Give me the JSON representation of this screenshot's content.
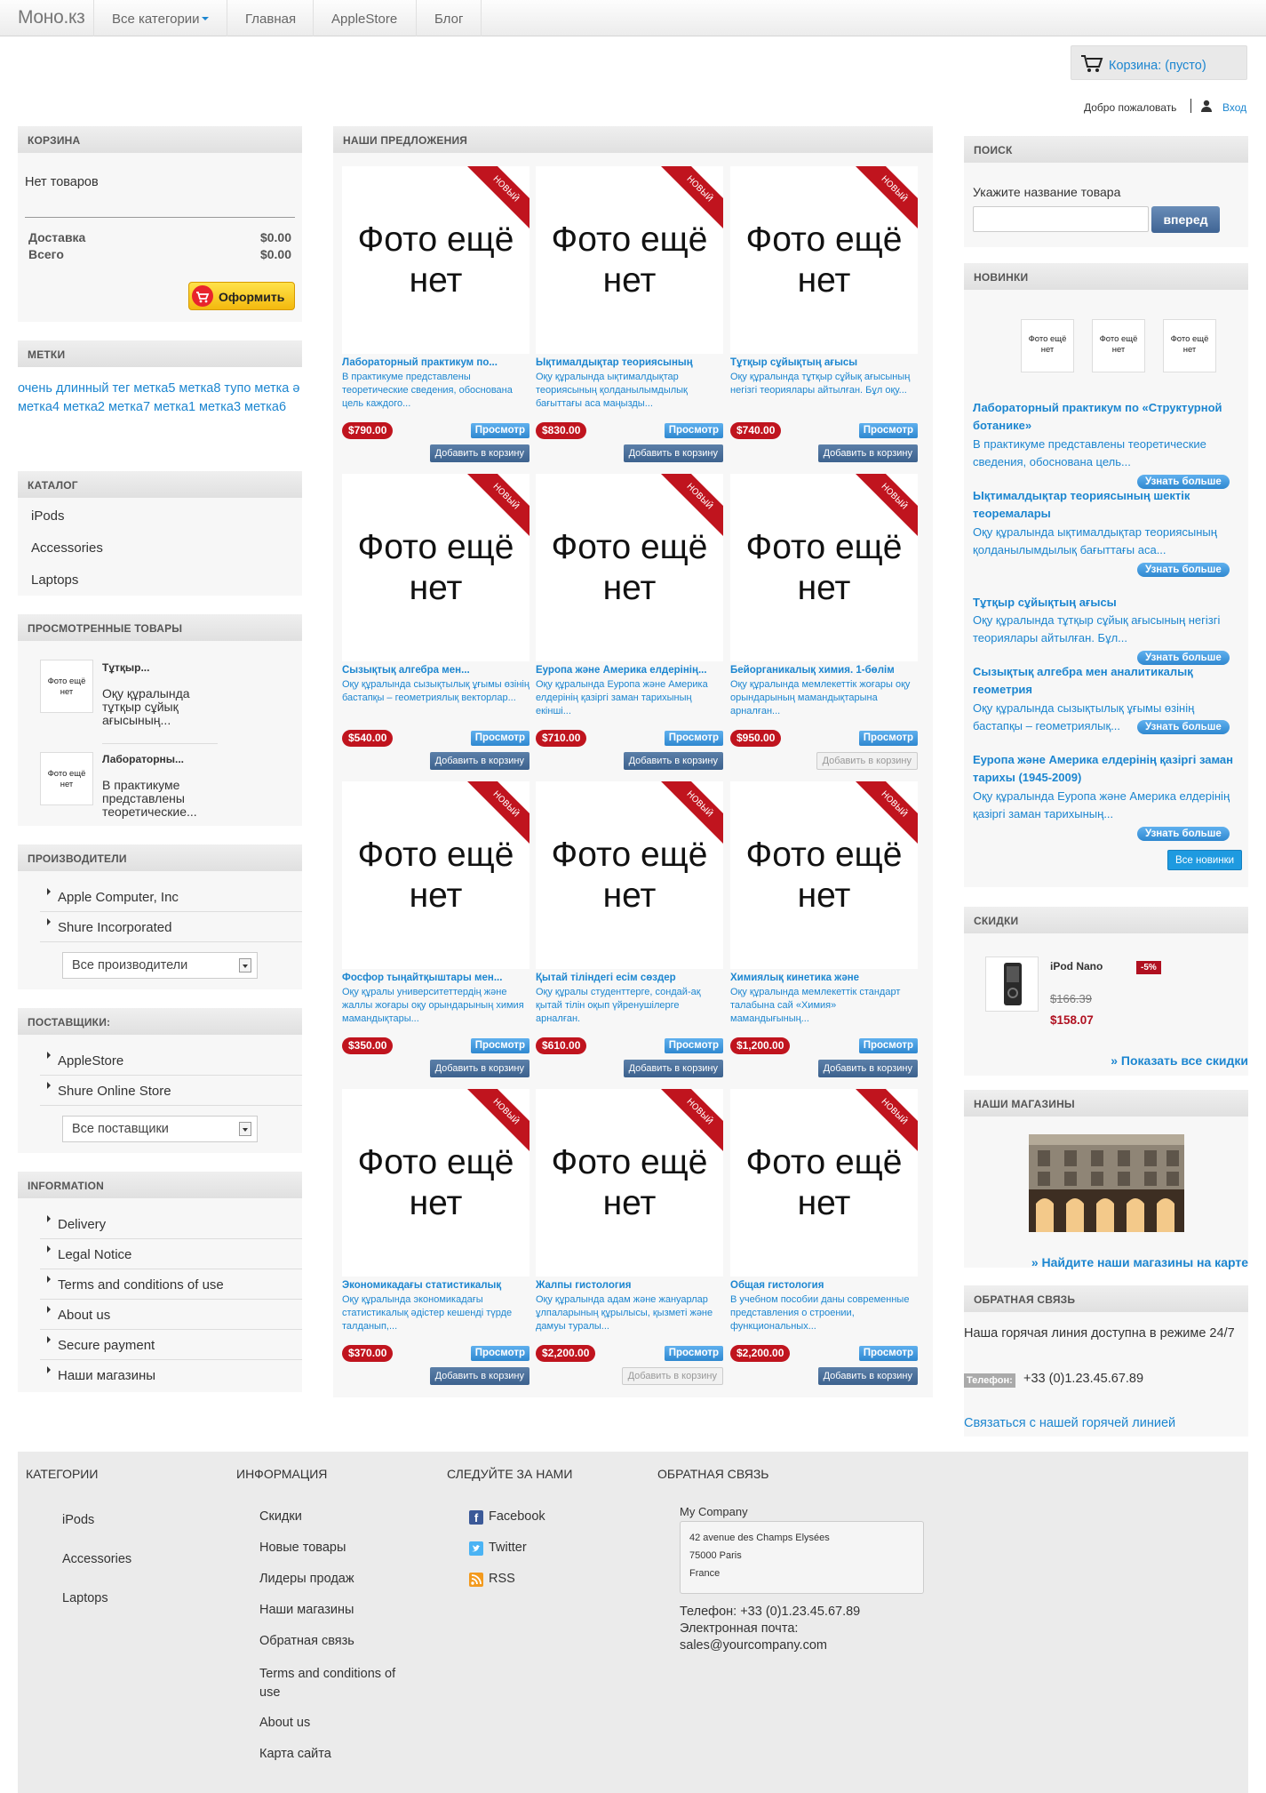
{
  "header": {
    "logo": "Моно.кз",
    "nav": [
      "Все категории",
      "Главная",
      "AppleStore",
      "Блог"
    ],
    "cart_label": "Корзина: (пусто)",
    "welcome": "Добро пожаловать",
    "login": "Вход"
  },
  "left": {
    "cart": {
      "title": "КОРЗИНА",
      "empty": "Нет товаров",
      "delivery_label": "Доставка",
      "delivery_value": "$0.00",
      "total_label": "Всего",
      "total_value": "$0.00",
      "checkout": "Оформить"
    },
    "tags": {
      "title": "МЕТКИ",
      "text": "очень длинный тег метка5 метка8 тупо метка ә метка4 метка2 метка7 метка1 метка3 метка6"
    },
    "catalog": {
      "title": "КАТАЛОГ",
      "items": [
        "iPods",
        "Accessories",
        "Laptops"
      ]
    },
    "viewed": {
      "title": "ПРОСМОТРЕННЫЕ ТОВАРЫ",
      "items": [
        {
          "thumb": "Фото ещё нет",
          "name": "Тұтқыр...",
          "desc": "Оқу құралында тұтқыр сұйық ағысының..."
        },
        {
          "thumb": "Фото ещё нет",
          "name": "Лабораторны...",
          "desc": "В практикуме представлены теоретические..."
        }
      ]
    },
    "manufacturers": {
      "title": "ПРОИЗВОДИТЕЛИ",
      "items": [
        "Apple Computer, Inc",
        "Shure Incorporated"
      ],
      "select": "Все производители"
    },
    "suppliers": {
      "title": "ПОСТАВЩИКИ:",
      "items": [
        "AppleStore",
        "Shure Online Store"
      ],
      "select": "Все поставщики"
    },
    "information": {
      "title": "INFORMATION",
      "items": [
        "Delivery",
        "Legal Notice",
        "Terms and conditions of use",
        "About us",
        "Secure payment",
        "Наши магазины"
      ]
    }
  },
  "center": {
    "title": "НАШИ ПРЕДЛОЖЕНИЯ",
    "no_photo": "Фото ещё нет",
    "ribbon": "НОВЫЙ",
    "view_label": "Просмотр",
    "add_label": "Добавить в корзину",
    "products": [
      {
        "title": "Лабораторный практикум по...",
        "desc": "В практикуме представлены теоретические сведения, обоснована цель каждого...",
        "price": "$790.00",
        "add_enabled": true
      },
      {
        "title": "Ықтималдықтар теориясының",
        "desc": "Оқу құралында ықтималдықтар теориясының қолданылымдылық бағыттағы аса маңызды...",
        "price": "$830.00",
        "add_enabled": true
      },
      {
        "title": "Тұтқыр сұйықтың ағысы",
        "desc": "Оқу құралында тұтқыр сұйық ағысының негізгі теориялары айтылған. Бұл оқу...",
        "price": "$740.00",
        "add_enabled": true
      },
      {
        "title": "Сызықтық алгебра мен...",
        "desc": "Оқу құралында сызықтылық ұғымы өзінің бастапқы – геометриялық векторлар...",
        "price": "$540.00",
        "add_enabled": true
      },
      {
        "title": "Еуропа және Америка елдерінің...",
        "desc": "Оқу құралында Еуропа және Америка елдерінің қазіргі заман тарихының екінші...",
        "price": "$710.00",
        "add_enabled": true
      },
      {
        "title": "Бейорганикалық химия. 1-бөлім",
        "desc": "Оқу құралында мемлекеттік жоғары оқу орындарының мамандықтарына арналған...",
        "price": "$950.00",
        "add_enabled": false
      },
      {
        "title": "Фосфор тыңайтқыштары мен...",
        "desc": "Оқу құралы университеттердің және жаллы жоғары оқу орындарының химия мамандықтары...",
        "price": "$350.00",
        "add_enabled": true
      },
      {
        "title": "Қытай тіліндегі есім сөздер",
        "desc": "Оқу құралы студенттерге, сондай-ақ қытай тілін оқып үйренушілерге арналған.",
        "price": "$610.00",
        "add_enabled": true
      },
      {
        "title": "Химиялық кинетика және",
        "desc": "Оқу құралында мемлекеттік стандарт талабына сай «Химия» мамандығының...",
        "price": "$1,200.00",
        "add_enabled": true
      },
      {
        "title": "Экономикадағы статистикалық",
        "desc": "Оқу құралында экономикадағы статистикалық әдістер кешенді түрде талданып,...",
        "price": "$370.00",
        "add_enabled": true
      },
      {
        "title": "Жалпы гистология",
        "desc": "Оқу құралында адам және жануарлар ұлпаларының құрылысы, қызметі және дамуы туралы...",
        "price": "$2,200.00",
        "add_enabled": false
      },
      {
        "title": "Общая гистология",
        "desc": "В учебном пособии даны современные представления о строении, функциональных...",
        "price": "$2,200.00",
        "add_enabled": true
      }
    ]
  },
  "right": {
    "search": {
      "title": "ПОИСК",
      "label": "Укажите название товара",
      "placeholder": "",
      "button": "вперед"
    },
    "new": {
      "title": "НОВИНКИ",
      "thumb": "Фото ещё нет",
      "more": "Узнать больше",
      "all": "Все новинки",
      "items": [
        {
          "title": "Лабораторный практикум по «Структурной ботанике»",
          "desc": "В практикуме представлены теоретические сведения, обоснована цель..."
        },
        {
          "title": "Ықтималдықтар теориясының шектік теоремалары",
          "desc": "Оқу құралында ықтималдықтар теориясының қолданылымдылық бағыттағы аса..."
        },
        {
          "title": "Тұтқыр сұйықтың ағысы",
          "desc": "Оқу құралында тұтқыр сұйық ағысының негізгі теориялары айтылған. Бұл..."
        },
        {
          "title": "Сызықтық алгебра мен аналитикалық геометрия",
          "desc": "Оқу құралында сызықтылық ұғымы өзінің бастапқы – геометриялық..."
        },
        {
          "title": "Еуропа және Америка елдерінің қазіргі заман тарихы (1945-2009)",
          "desc": "Оқу құралында Еуропа және Америка елдерінің қазіргі заман тарихының..."
        }
      ]
    },
    "discounts": {
      "title": "СКИДКИ",
      "product": "iPod Nano",
      "badge": "-5%",
      "old_price": "$166.39",
      "new_price": "$158.07",
      "all": "» Показать все скидки"
    },
    "stores": {
      "title": "НАШИ МАГАЗИНЫ",
      "link": "» Найдите наши магазины на карте"
    },
    "contact": {
      "title": "ОБРАТНАЯ СВЯЗЬ",
      "hotline": "Наша горячая линия доступна в режиме 24/7",
      "phone_label": "Телефон:",
      "phone": "+33 (0)1.23.45.67.89",
      "link": "Связаться с нашей горячей линией"
    }
  },
  "footer": {
    "categories": {
      "title": "КАТЕГОРИИ",
      "items": [
        "iPods",
        "Accessories",
        "Laptops"
      ]
    },
    "info": {
      "title": "ИНФОРМАЦИЯ",
      "items": [
        "Скидки",
        "Новые товары",
        "Лидеры продаж",
        "Наши магазины",
        "Обратная связь",
        "Terms and conditions of use",
        "About us",
        "Карта сайта"
      ]
    },
    "follow": {
      "title": "СЛЕДУЙТЕ ЗА НАМИ",
      "items": [
        "Facebook",
        "Twitter",
        "RSS"
      ]
    },
    "contact": {
      "title": "ОБРАТНАЯ СВЯЗЬ",
      "company": "My Company",
      "address": [
        "42 avenue des Champs Elysées",
        "75000 Paris",
        "France"
      ],
      "phone": "Телефон: +33 (0)1.23.45.67.89",
      "email_label": "Электронная почта:",
      "email": "sales@yourcompany.com"
    }
  }
}
